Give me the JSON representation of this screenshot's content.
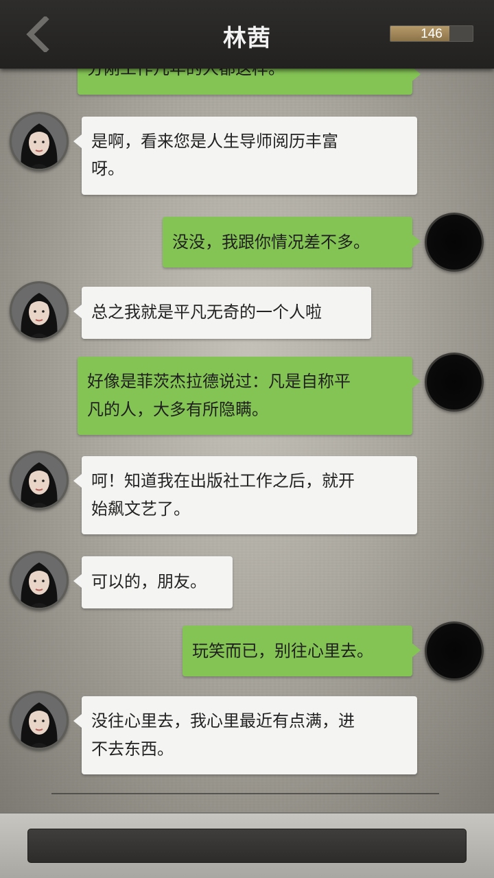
{
  "header": {
    "title": "林茜",
    "score": "146",
    "score_fraction": 0.72
  },
  "messages": [
    {
      "side": "right",
      "lines": [
        "分刚工作几年的人都这样。"
      ]
    },
    {
      "side": "left",
      "lines": [
        "是啊，看来您是人生导师阅历丰富",
        "呀。"
      ]
    },
    {
      "side": "right",
      "lines": [
        "没没，我跟你情况差不多。"
      ]
    },
    {
      "side": "left",
      "lines": [
        "总之我就是平凡无奇的一个人啦"
      ]
    },
    {
      "side": "right",
      "lines": [
        "好像是菲茨杰拉德说过：凡是自称平",
        "凡的人，大多有所隐瞒。"
      ]
    },
    {
      "side": "left",
      "lines": [
        "呵！知道我在出版社工作之后，就开",
        "始飙文艺了。"
      ]
    },
    {
      "side": "left",
      "lines": [
        "可以的，朋友。"
      ]
    },
    {
      "side": "right",
      "lines": [
        "玩笑而已，别往心里去。"
      ]
    },
    {
      "side": "left",
      "lines": [
        "没往心里去，我心里最近有点满，进",
        "不去东西。"
      ]
    }
  ],
  "icons": {
    "back": "chevron-left-icon"
  }
}
